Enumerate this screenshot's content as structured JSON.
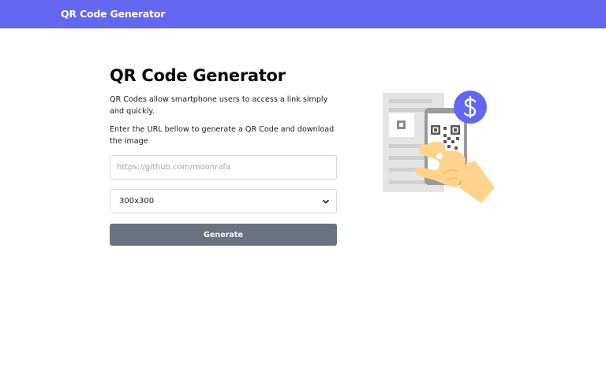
{
  "navbar": {
    "brand": "QR Code Generator"
  },
  "main": {
    "title": "QR Code Generator",
    "description_1": "QR Codes allow smartphone users to access a link simply and quickly.",
    "description_2": "Enter the URL bellow to generate a QR Code and download the image",
    "url_input": {
      "placeholder": "https://github.com/moonrafa",
      "value": ""
    },
    "size_select": {
      "selected": "300x300"
    },
    "generate_label": "Generate"
  },
  "colors": {
    "accent": "#6366f1",
    "button": "#6b7280",
    "illustration_accent": "#6366f1",
    "hand": "#ffd38a"
  },
  "icons": [
    "chevron-down-icon",
    "dollar-icon",
    "qr-code-icon",
    "phone-icon",
    "hand-icon"
  ]
}
